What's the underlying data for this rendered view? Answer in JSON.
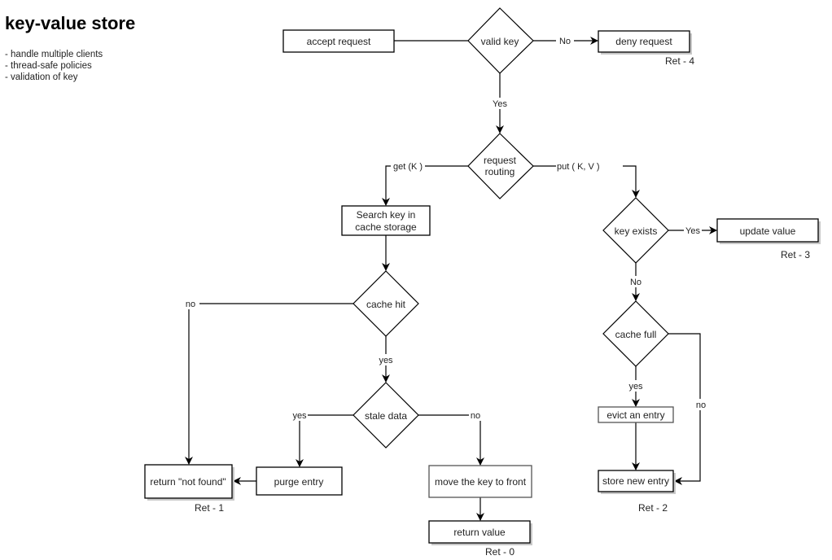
{
  "header": {
    "title": "key-value store",
    "notes": [
      "- handle multiple clients",
      "- thread-safe policies",
      "- validation of key"
    ]
  },
  "nodes": {
    "accept_request": "accept request",
    "valid_key": "valid key",
    "deny_request": "deny request",
    "request_routing": [
      "request",
      "routing"
    ],
    "search_key": [
      "Search key in",
      "cache storage"
    ],
    "cache_hit": "cache hit",
    "stale_data": "stale data",
    "return_not_found": "return \"not found\"",
    "purge_entry": "purge entry",
    "move_key_front": "move the key to front",
    "return_value": "return value",
    "key_exists": "key exists",
    "update_value": "update value",
    "cache_full": "cache full",
    "evict_entry": "evict an entry",
    "store_new_entry": "store new entry"
  },
  "edge_labels": {
    "valid_no": "No",
    "valid_yes": "Yes",
    "route_get": "get (K )",
    "route_put": "put ( K, V )",
    "hit_no": "no",
    "hit_yes": "yes",
    "stale_yes": "yes",
    "stale_no": "no",
    "exists_yes": "Yes",
    "exists_no": "No",
    "full_yes": "yes",
    "full_no": "no"
  },
  "return_codes": {
    "deny": "Ret - 4",
    "update": "Ret - 3",
    "not_found": "Ret - 1",
    "return_value": "Ret - 0",
    "store": "Ret - 2"
  }
}
